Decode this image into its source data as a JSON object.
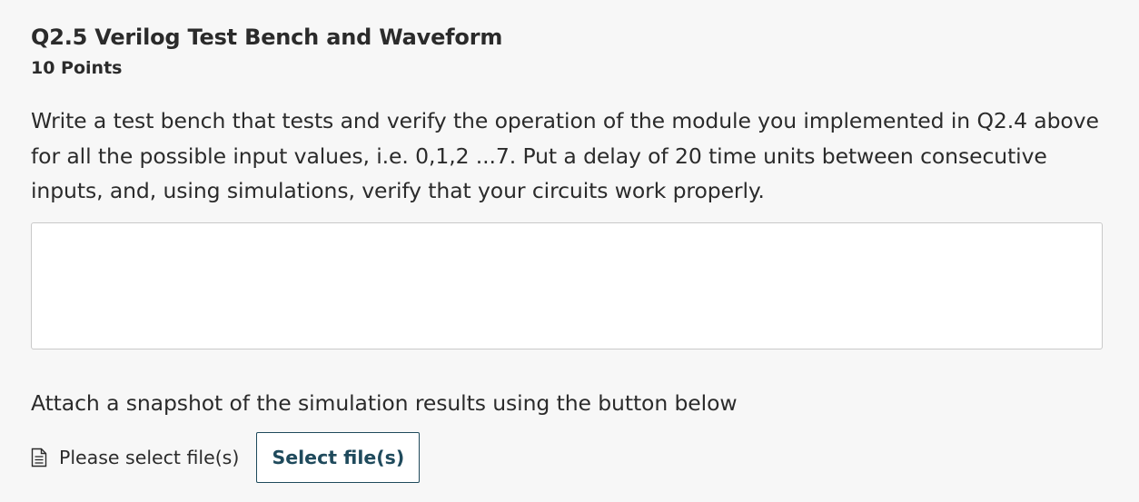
{
  "question": {
    "title": "Q2.5 Verilog Test Bench and Waveform",
    "points": "10 Points",
    "body": "Write a test bench that tests and verify the operation of the module you implemented in Q2.4 above for all the possible input values, i.e. 0,1,2 ...7. Put a delay of 20 time units between consecutive inputs, and, using simulations, verify that your circuits work properly."
  },
  "answer": {
    "value": ""
  },
  "attachment": {
    "instruction": "Attach a snapshot of the simulation results using the button below",
    "status_text": "Please select file(s)",
    "status_icon": "document-icon",
    "button_label": "Select file(s)"
  },
  "colors": {
    "background": "#f7f7f7",
    "text": "#2b2b2b",
    "button_accent": "#1f4a5c",
    "input_border": "#c9c9c9"
  }
}
